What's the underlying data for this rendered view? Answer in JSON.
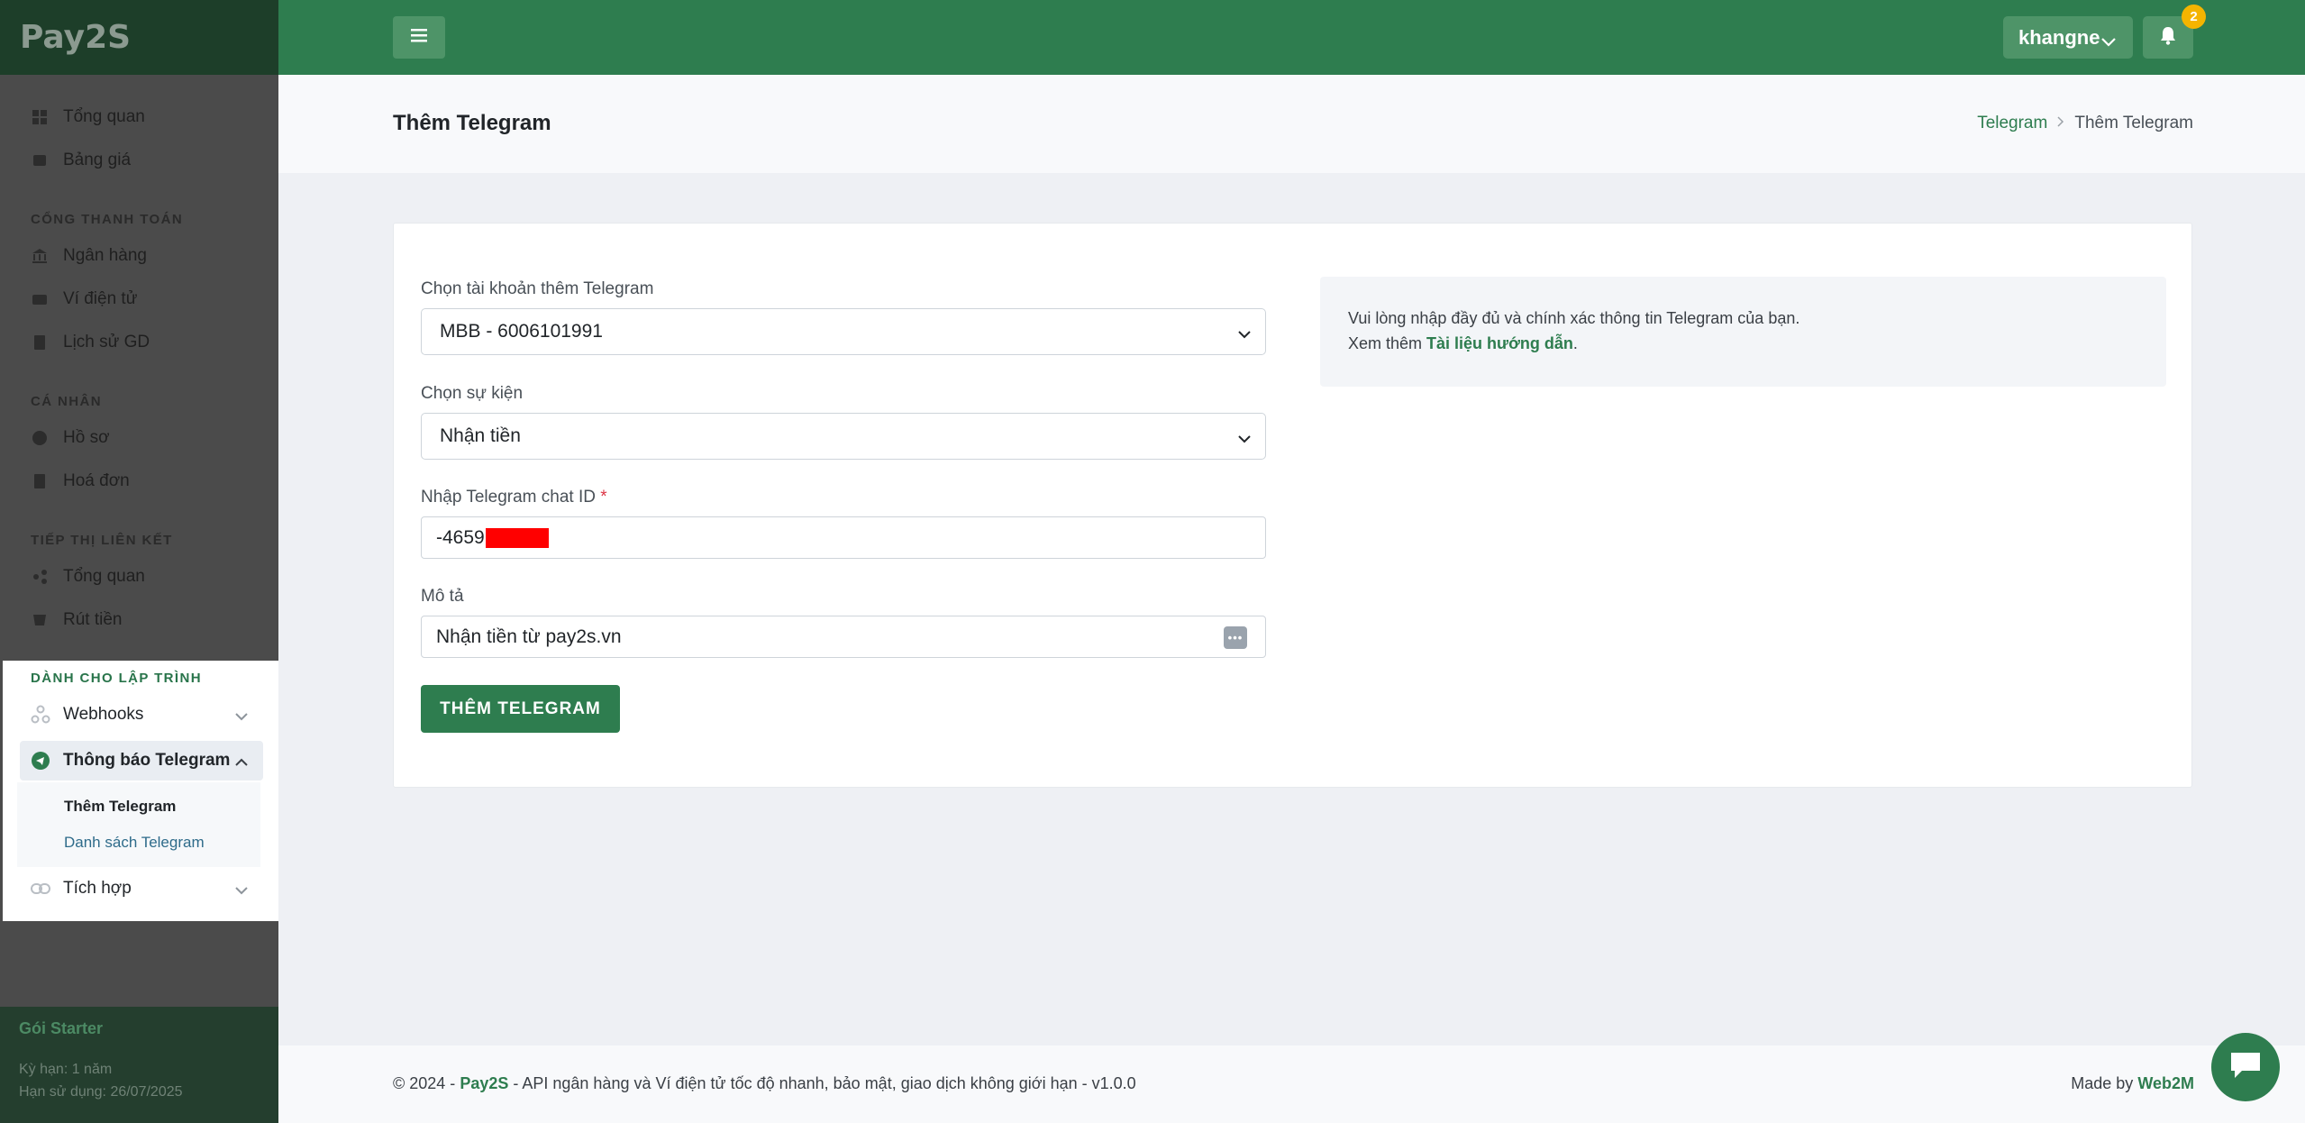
{
  "brand": {
    "logo_text": "Pay2S"
  },
  "sidebar": {
    "items_top": [
      {
        "label": "Tổng quan",
        "icon": "grid-icon"
      },
      {
        "label": "Bảng giá",
        "icon": "price-icon"
      }
    ],
    "sections": [
      {
        "header": "CỔNG THANH TOÁN",
        "items": [
          {
            "label": "Ngân hàng",
            "icon": "bank-icon"
          },
          {
            "label": "Ví điện tử",
            "icon": "wallet-icon"
          },
          {
            "label": "Lịch sử GD",
            "icon": "history-icon"
          }
        ]
      },
      {
        "header": "CÁ NHÂN",
        "items": [
          {
            "label": "Hồ sơ",
            "icon": "user-icon"
          },
          {
            "label": "Hoá đơn",
            "icon": "invoice-icon"
          }
        ]
      },
      {
        "header": "TIẾP THỊ LIÊN KẾT",
        "items": [
          {
            "label": "Tổng quan",
            "icon": "affiliate-icon"
          },
          {
            "label": "Rút tiền",
            "icon": "withdraw-icon"
          }
        ]
      }
    ],
    "dev": {
      "header": "DÀNH CHO LẬP TRÌNH",
      "webhooks": "Webhooks",
      "telegram": "Thông báo Telegram",
      "sub_add": "Thêm Telegram",
      "sub_list": "Danh sách Telegram",
      "integration": "Tích hợp"
    },
    "plan": {
      "title": "Gói Starter",
      "term": "Kỳ hạn: 1 năm",
      "expiry": "Hạn sử dụng: 26/07/2025"
    }
  },
  "topbar": {
    "username": "khangne",
    "notification_count": "2"
  },
  "page": {
    "title": "Thêm Telegram",
    "breadcrumb": {
      "parent": "Telegram",
      "current": "Thêm Telegram"
    }
  },
  "form": {
    "account_label": "Chọn tài khoản thêm Telegram",
    "account_value": "MBB - 6006101991",
    "event_label": "Chọn sự kiện",
    "event_value": "Nhận tiền",
    "chat_id_label": "Nhập Telegram chat ID",
    "chat_id_required": "*",
    "chat_id_value": "-4659",
    "desc_label": "Mô tả",
    "desc_value": "Nhận tiền từ pay2s.vn",
    "submit_label": "THÊM TELEGRAM"
  },
  "info": {
    "line1": "Vui lòng nhập đầy đủ và chính xác thông tin Telegram của bạn.",
    "line2_prefix": "Xem thêm ",
    "line2_link": "Tài liệu hướng dẫn",
    "line2_suffix": "."
  },
  "footer": {
    "copyright": "© 2024 - ",
    "brand_link": "Pay2S",
    "tagline": " - API ngân hàng và Ví điện tử tốc độ nhanh, bảo mật, giao dịch không giới hạn - v1.0.0",
    "made_by": "Made by ",
    "made_by_link": "Web2M"
  },
  "colors": {
    "primary": "#2e7d4f",
    "badge": "#f4b400",
    "required": "#dc3545"
  }
}
